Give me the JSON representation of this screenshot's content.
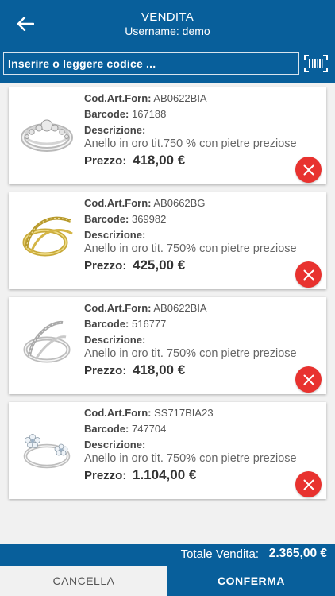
{
  "header": {
    "title": "VENDITA",
    "subtitle": "Username: demo",
    "back_icon": "arrow-left-icon"
  },
  "search": {
    "placeholder": "Inserire o leggere codice ...",
    "value": "",
    "scan_icon": "barcode-icon"
  },
  "labels": {
    "cod_art": "Cod.Art.Forn:",
    "barcode": "Barcode:",
    "descrizione": "Descrizione:",
    "prezzo": "Prezzo:"
  },
  "items": [
    {
      "cod_art": "AB0622BIA",
      "barcode": "167188",
      "description": "Anello in oro tit.750 % con pietre preziose",
      "price": "418,00 €"
    },
    {
      "cod_art": "AB0662BG",
      "barcode": "369982",
      "description": "Anello in oro tit. 750% con pietre preziose",
      "price": "425,00 €"
    },
    {
      "cod_art": "AB0622BIA",
      "barcode": "516777",
      "description": "Anello in oro tit. 750% con pietre preziose",
      "price": "418,00 €"
    },
    {
      "cod_art": "SS717BIA23",
      "barcode": "747704",
      "description": "Anello in oro tit. 750% con pietre preziose",
      "price": "1.104,00 €"
    }
  ],
  "total": {
    "label": "Totale Vendita:",
    "value": "2.365,00 €"
  },
  "actions": {
    "cancel": "CANCELLA",
    "confirm": "CONFERMA"
  },
  "colors": {
    "primary": "#085f9b",
    "delete": "#e8322f",
    "background": "#f1f1f1"
  }
}
